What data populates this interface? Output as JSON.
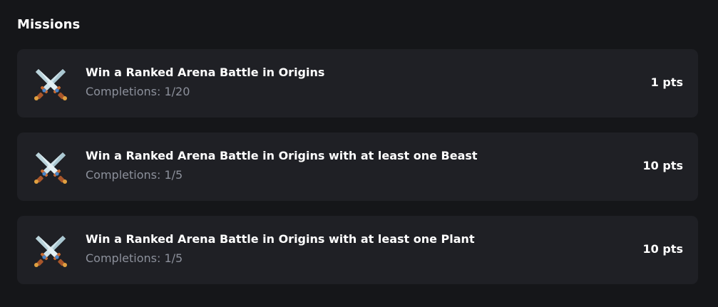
{
  "section": {
    "title": "Missions"
  },
  "icons": {
    "mission": "crossed-swords-icon"
  },
  "missions": [
    {
      "title": "Win a Ranked Arena Battle in Origins",
      "progress": "Completions: 1/20",
      "points": "1 pts"
    },
    {
      "title": "Win a Ranked Arena Battle in Origins with at least one Beast",
      "progress": "Completions: 1/5",
      "points": "10 pts"
    },
    {
      "title": "Win a Ranked Arena Battle in Origins with at least one Plant",
      "progress": "Completions: 1/5",
      "points": "10 pts"
    }
  ],
  "colors": {
    "background": "#151619",
    "card": "#1f2025",
    "text_primary": "#ffffff",
    "text_secondary": "#8c909b"
  }
}
